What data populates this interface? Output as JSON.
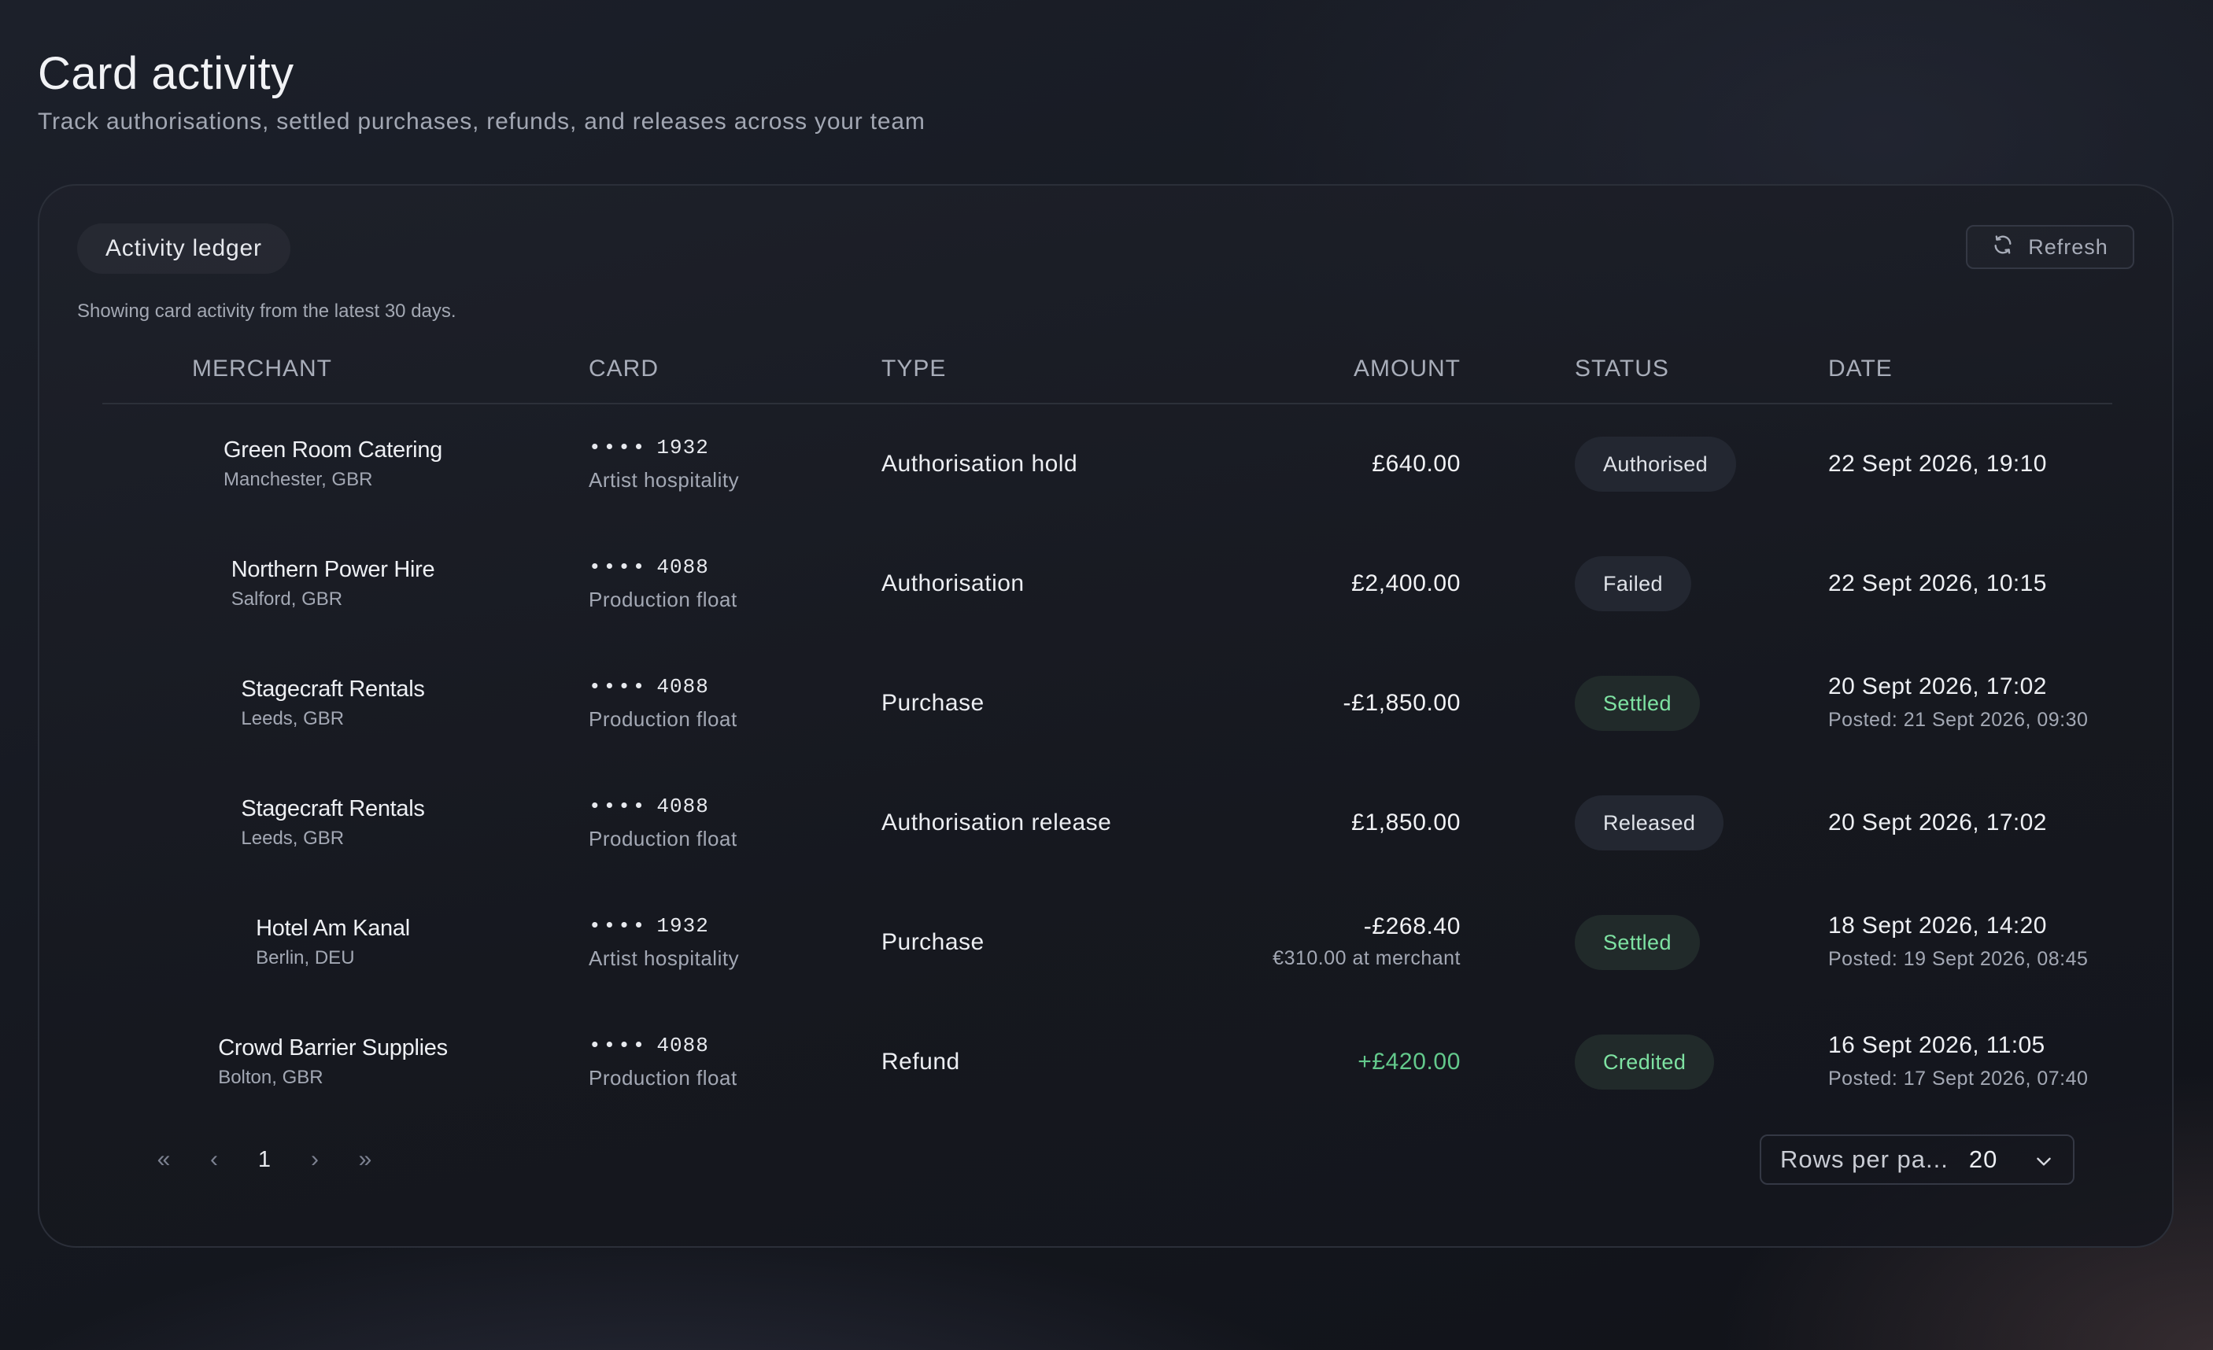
{
  "header": {
    "title": "Card activity",
    "subtitle": "Track authorisations, settled purchases, refunds, and releases across your team"
  },
  "panel": {
    "chip_label": "Activity ledger",
    "refresh_label": "Refresh",
    "refresh_icon": "refresh-icon",
    "caption": "Showing card activity from the latest 30 days."
  },
  "table": {
    "columns": [
      "MERCHANT",
      "CARD",
      "TYPE",
      "AMOUNT",
      "STATUS",
      "DATE"
    ],
    "rows": [
      {
        "merchant": "Green Room Catering",
        "location": "Manchester, GBR",
        "card_mask": "••••",
        "card_last4": "1932",
        "card_label": "Artist hospitality",
        "type": "Authorisation hold",
        "amount": "£640.00",
        "amount_note": "",
        "status": "Authorised",
        "date": "22 Sept 2026, 19:10",
        "posted": ""
      },
      {
        "merchant": "Northern Power Hire",
        "location": "Salford, GBR",
        "card_mask": "••••",
        "card_last4": "4088",
        "card_label": "Production float",
        "type": "Authorisation",
        "amount": "£2,400.00",
        "amount_note": "",
        "status": "Failed",
        "date": "22 Sept 2026, 10:15",
        "posted": ""
      },
      {
        "merchant": "Stagecraft Rentals",
        "location": "Leeds, GBR",
        "card_mask": "••••",
        "card_last4": "4088",
        "card_label": "Production float",
        "type": "Purchase",
        "amount": "-£1,850.00",
        "amount_note": "",
        "status": "Settled",
        "date": "20 Sept 2026, 17:02",
        "posted": "Posted: 21 Sept 2026, 09:30"
      },
      {
        "merchant": "Stagecraft Rentals",
        "location": "Leeds, GBR",
        "card_mask": "••••",
        "card_last4": "4088",
        "card_label": "Production float",
        "type": "Authorisation release",
        "amount": "£1,850.00",
        "amount_note": "",
        "status": "Released",
        "date": "20 Sept 2026, 17:02",
        "posted": ""
      },
      {
        "merchant": "Hotel Am Kanal",
        "location": "Berlin, DEU",
        "card_mask": "••••",
        "card_last4": "1932",
        "card_label": "Artist hospitality",
        "type": "Purchase",
        "amount": "-£268.40",
        "amount_note": "€310.00 at merchant",
        "status": "Settled",
        "date": "18 Sept 2026, 14:20",
        "posted": "Posted: 19 Sept 2026, 08:45"
      },
      {
        "merchant": "Crowd Barrier Supplies",
        "location": "Bolton, GBR",
        "card_mask": "••••",
        "card_last4": "4088",
        "card_label": "Production float",
        "type": "Refund",
        "amount": "+£420.00",
        "amount_note": "",
        "status": "Credited",
        "date": "16 Sept 2026, 11:05",
        "posted": "Posted: 17 Sept 2026, 07:40"
      }
    ]
  },
  "pagination": {
    "first": "«",
    "prev": "‹",
    "page": "1",
    "next": "›",
    "last": "»",
    "rows_per_page_label": "Rows per pa...",
    "rows_per_page_value": "20"
  },
  "colors": {
    "background": "#161921",
    "positive_amount": "#63c98c",
    "status_green": "#7ee2a2",
    "muted_text": "#a3a8b4"
  }
}
